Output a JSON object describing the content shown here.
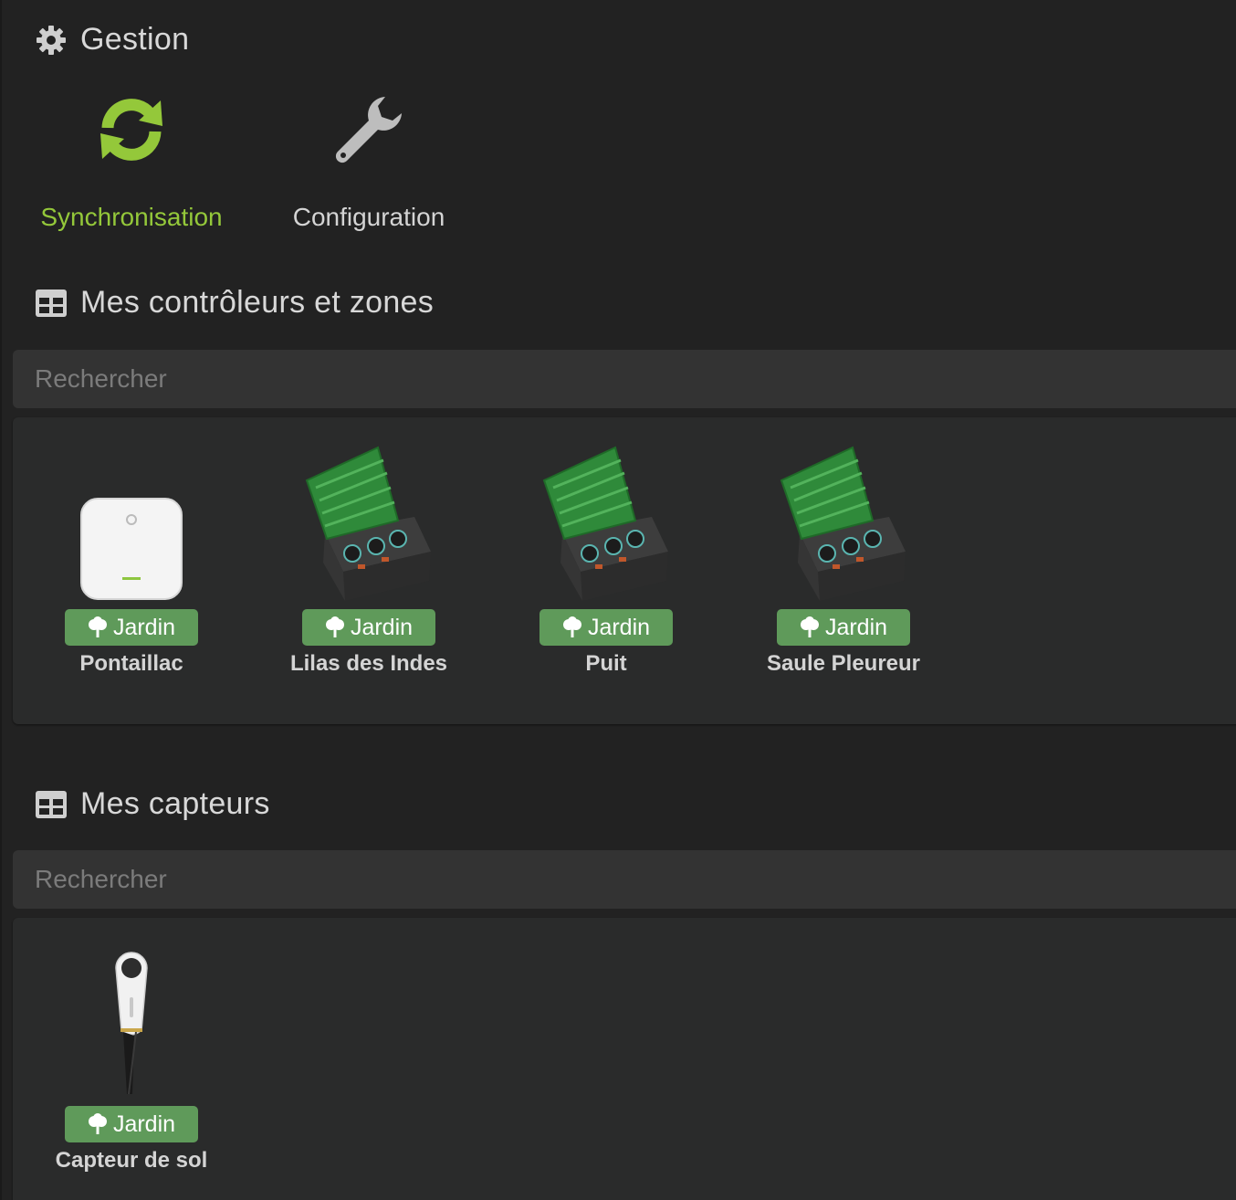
{
  "management": {
    "title": "Gestion",
    "title_icon": "gear-icon",
    "actions": [
      {
        "label": "Synchronisation",
        "icon": "sync-icon",
        "color": "#94c83a",
        "active": true
      },
      {
        "label": "Configuration",
        "icon": "wrench-icon",
        "color": "#bdbdbd",
        "active": false
      }
    ]
  },
  "controllers": {
    "title": "Mes contrôleurs et zones",
    "title_icon": "table-icon",
    "search": {
      "placeholder": "Rechercher",
      "value": ""
    },
    "items": [
      {
        "name": "Pontaillac",
        "badge": "Jardin",
        "icon": "controller-device-image"
      },
      {
        "name": "Lilas des Indes",
        "badge": "Jardin",
        "icon": "valve-box-image"
      },
      {
        "name": "Puit",
        "badge": "Jardin",
        "icon": "valve-box-image"
      },
      {
        "name": "Saule Pleureur",
        "badge": "Jardin",
        "icon": "valve-box-image"
      }
    ]
  },
  "sensors": {
    "title": "Mes capteurs",
    "title_icon": "table-icon",
    "search": {
      "placeholder": "Rechercher",
      "value": ""
    },
    "items": [
      {
        "name": "Capteur de sol",
        "badge": "Jardin",
        "icon": "soil-sensor-image"
      }
    ]
  },
  "colors": {
    "accent": "#94c83a",
    "badge": "#5f9a5a",
    "background": "#222222",
    "panel": "#2a2b2b"
  }
}
